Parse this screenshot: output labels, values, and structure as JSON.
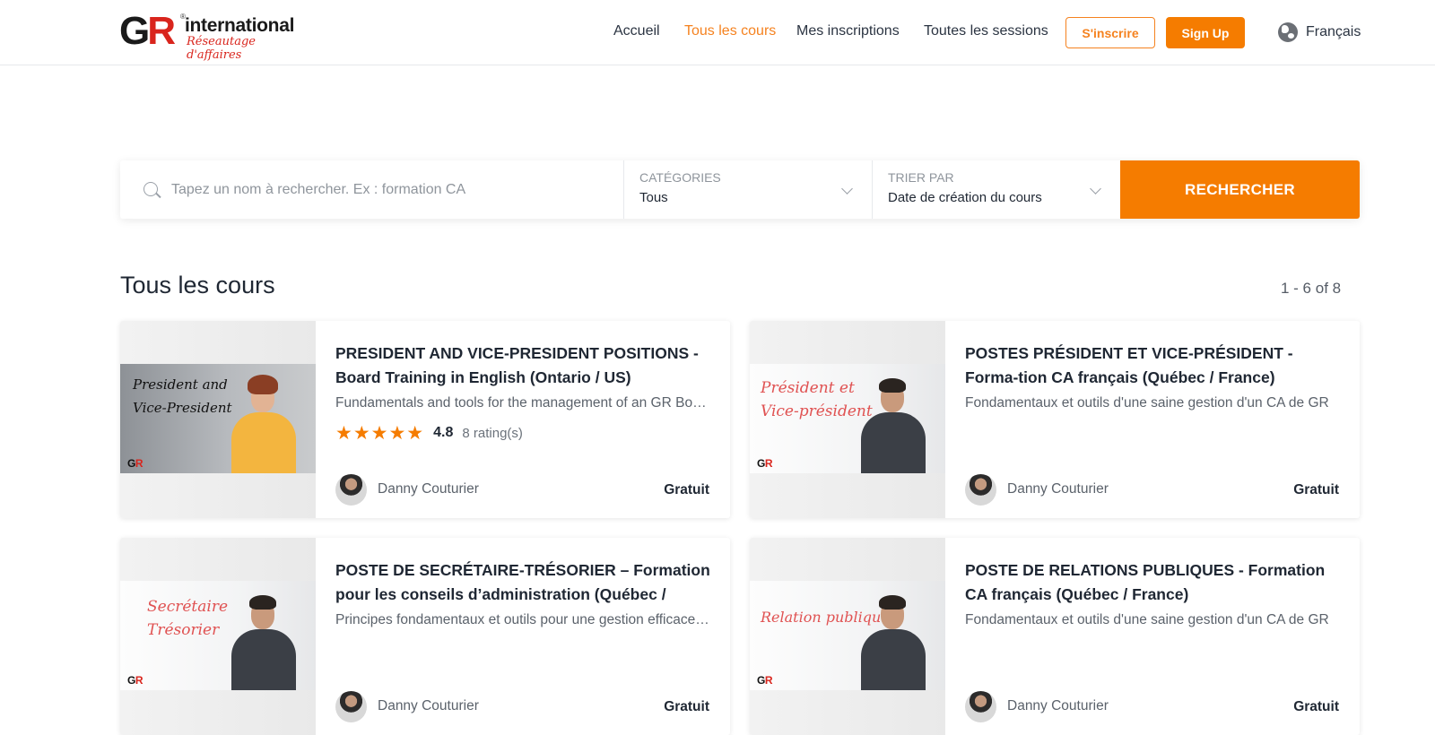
{
  "header": {
    "logo": {
      "mark": "GR",
      "name": "international",
      "tagline": "Réseautage d'affaires"
    },
    "nav": [
      "Accueil",
      "Tous les cours",
      "Mes inscriptions",
      "Toutes les sessions"
    ],
    "active_nav": "Tous les cours",
    "signup_fr": "S'inscrire",
    "signup_en": "Sign Up",
    "language": "Français",
    "accent_color": "#f57c00"
  },
  "search": {
    "placeholder": "Tapez un nom à rechercher. Ex : formation CA",
    "category_label": "CATÉGORIES",
    "category_value": "Tous",
    "sort_label": "TRIER PAR",
    "sort_value": "Date de création du cours",
    "button": "RECHERCHER"
  },
  "section": {
    "title": "Tous les cours",
    "count": "1 - 6 of 8"
  },
  "courses": [
    {
      "title": "PRESIDENT AND VICE-PRESIDENT POSITIONS - Board Training in English (Ontario / US)",
      "description": "Fundamentals and tools for the management of an GR Board",
      "thumb_line1": "President and",
      "thumb_line2": "Vice-President",
      "rating": "4.8",
      "rating_count": "8 rating(s)",
      "stars": 5,
      "author": "Danny Couturier",
      "price": "Gratuit"
    },
    {
      "title": "POSTES PRÉSIDENT ET VICE-PRÉSIDENT - Forma-tion CA français (Québec / France)",
      "description": "Fondamentaux et outils d'une saine gestion d'un CA de GR",
      "thumb_line1": "Président et",
      "thumb_line2": "Vice-président",
      "author": "Danny Couturier",
      "price": "Gratuit"
    },
    {
      "title": "POSTE DE SECRÉTAIRE-TRÉSORIER – Formation pour les conseils d’administration (Québec / France)",
      "description": "Principes fondamentaux et outils pour une gestion efficace d'un CA",
      "thumb_line1": "Secrétaire",
      "thumb_line2": "Trésorier",
      "author": "Danny Couturier",
      "price": "Gratuit"
    },
    {
      "title": "POSTE DE RELATIONS PUBLIQUES - Formation CA français (Québec / France)",
      "description": "Fondamentaux et outils d'une saine gestion d'un CA de GR",
      "thumb_line1": "Relation publique",
      "thumb_line2": "",
      "author": "Danny Couturier",
      "price": "Gratuit"
    }
  ]
}
